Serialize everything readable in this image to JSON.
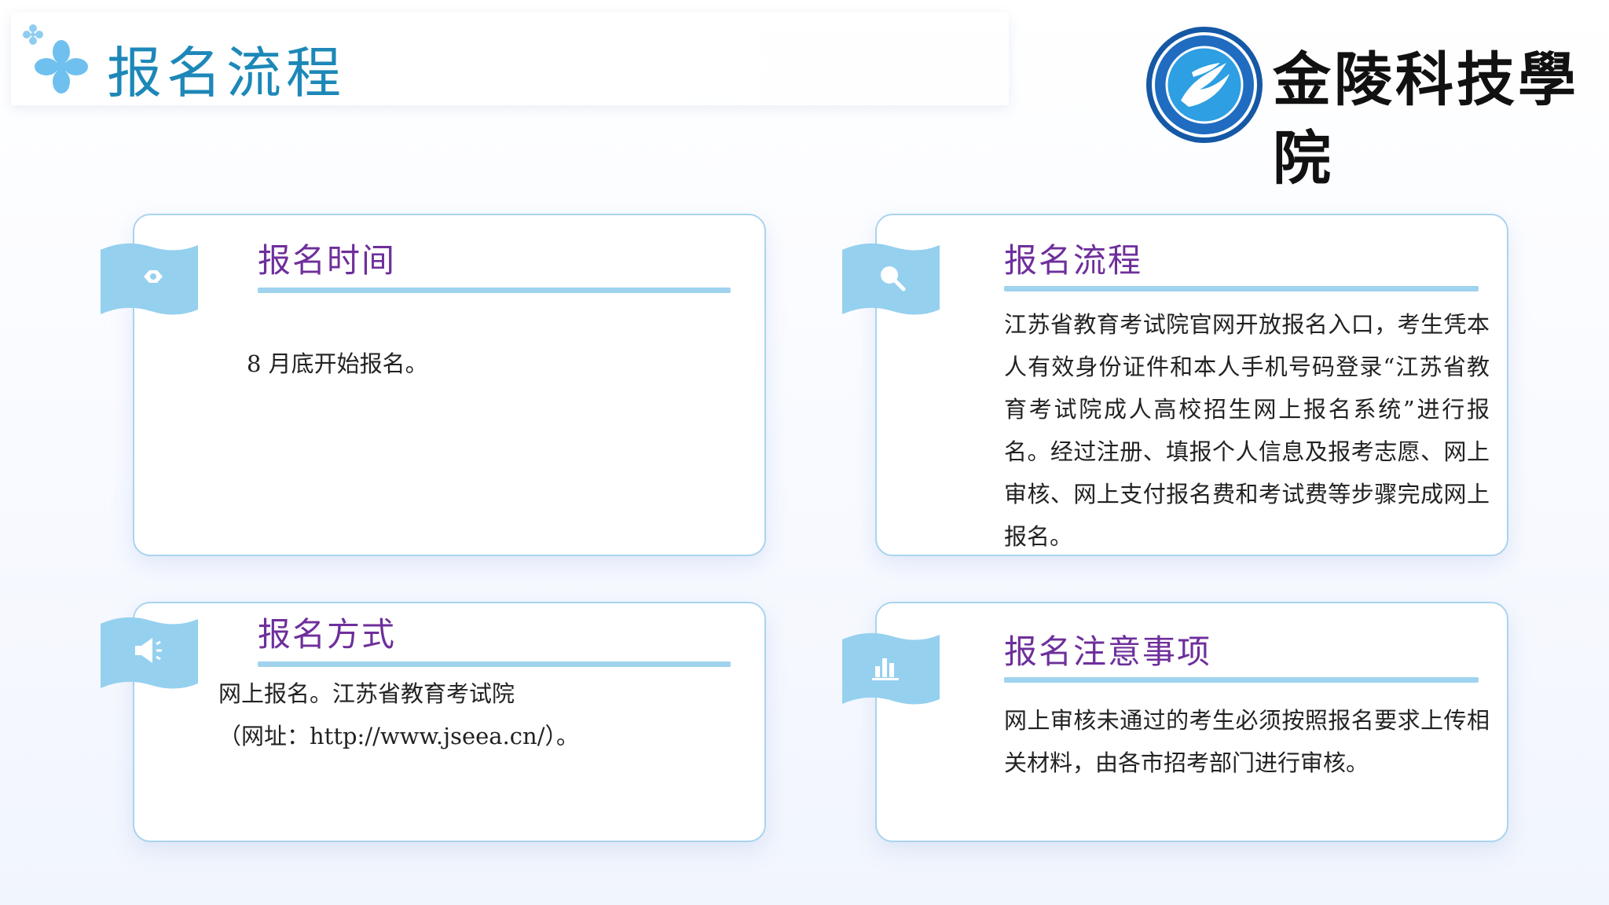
{
  "header": {
    "title": "报名流程",
    "logo_name": "金陵科技學院"
  },
  "cards": [
    {
      "icon": "hexagon-nut-icon",
      "title": "报名时间",
      "text": "8 月底开始报名。"
    },
    {
      "icon": "magnifier-icon",
      "title": "报名流程",
      "text": "江苏省教育考试院官网开放报名入口，考生凭本人有效身份证件和本人手机号码登录“江苏省教育考试院成人高校招生网上报名系统”进行报名。经过注册、填报个人信息及报考志愿、网上审核、网上支付报名费和考试费等步骤完成网上报名。"
    },
    {
      "icon": "megaphone-icon",
      "title": "报名方式",
      "text_line1": "网上报名。江苏省教育考试院",
      "text_line2": "（网址：http://www.jseea.cn/）。"
    },
    {
      "icon": "bar-chart-icon",
      "title": "报名注意事项",
      "text": "网上审核未通过的考生必须按照报名要求上传相关材料，由各市招考部门进行审核。"
    }
  ],
  "colors": {
    "title": "#1d88b8",
    "card_title": "#6e2f9b",
    "accent": "#9fd3ee",
    "border": "#a9d4ee"
  }
}
